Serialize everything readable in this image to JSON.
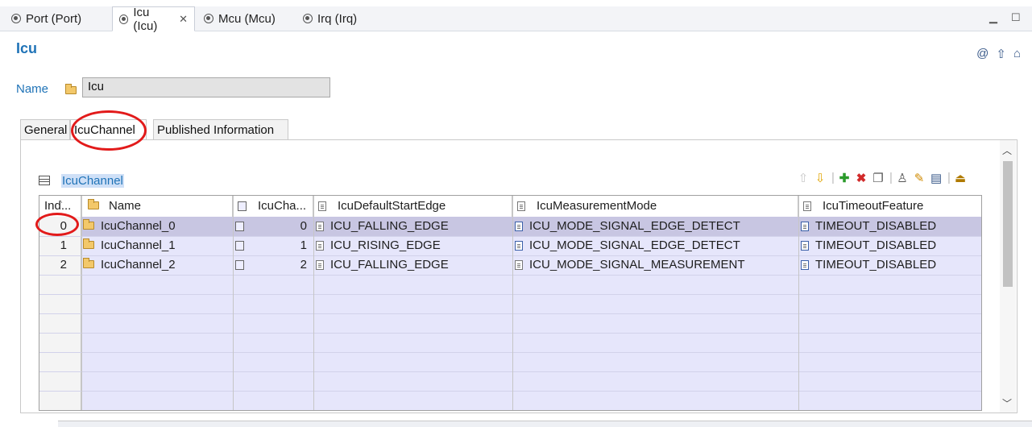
{
  "editor_tabs": [
    {
      "label": "Port (Port)",
      "active": false
    },
    {
      "label": "Icu (Icu)",
      "active": true,
      "close": "✕"
    },
    {
      "label": "Mcu (Mcu)",
      "active": false
    },
    {
      "label": "Irq (Irq)",
      "active": false
    }
  ],
  "form": {
    "title": "Icu",
    "name_label": "Name",
    "name_value": "Icu"
  },
  "subtabs": [
    "General",
    "IcuChannel",
    "Published Information"
  ],
  "section": {
    "title": "IcuChannel"
  },
  "toolbar": [
    "move-up",
    "move-down",
    "add",
    "delete",
    "copy",
    "person",
    "edit",
    "edit-table",
    "export"
  ],
  "table": {
    "columns": [
      "Ind...",
      "Name",
      "IcuCha...",
      "IcuDefaultStartEdge",
      "IcuMeasurementMode",
      "IcuTimeoutFeature"
    ],
    "rows": [
      {
        "index": "0",
        "name": "IcuChannel_0",
        "id": "0",
        "edge": "ICU_FALLING_EDGE",
        "mode": "ICU_MODE_SIGNAL_EDGE_DETECT",
        "timeout": "TIMEOUT_DISABLED",
        "selected": true
      },
      {
        "index": "1",
        "name": "IcuChannel_1",
        "id": "1",
        "edge": "ICU_RISING_EDGE",
        "mode": "ICU_MODE_SIGNAL_EDGE_DETECT",
        "timeout": "TIMEOUT_DISABLED",
        "selected": false
      },
      {
        "index": "2",
        "name": "IcuChannel_2",
        "id": "2",
        "edge": "ICU_FALLING_EDGE",
        "mode": "ICU_MODE_SIGNAL_MEASUREMENT",
        "timeout": "TIMEOUT_DISABLED",
        "selected": false
      }
    ]
  },
  "colors": {
    "accent": "#1f73b7",
    "highlight": "#e21a1a",
    "selected_row": "#c8c6e2",
    "row_fill": "#e6e6fb"
  }
}
